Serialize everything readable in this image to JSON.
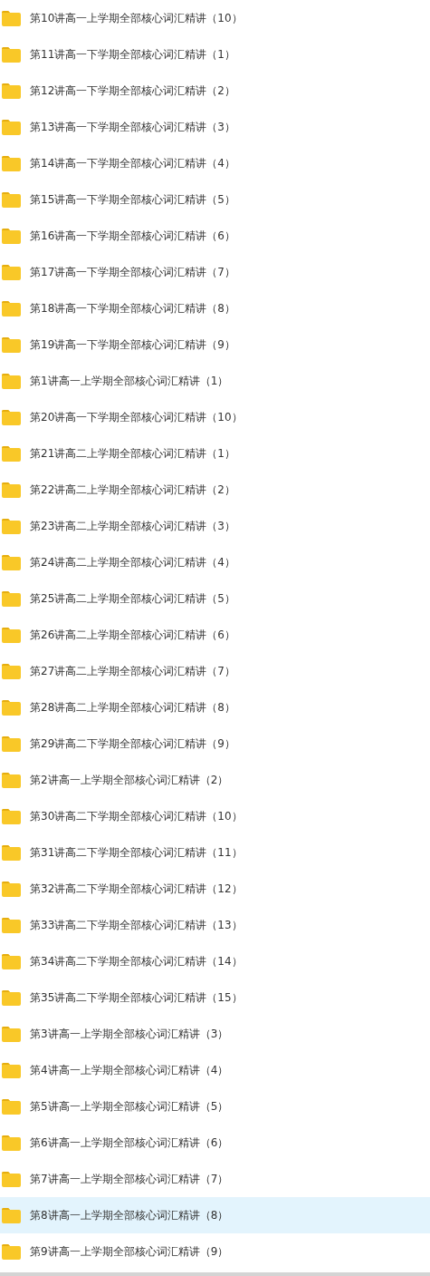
{
  "folders": [
    {
      "name": "第10讲高一上学期全部核心词汇精讲（10）",
      "selected": false
    },
    {
      "name": "第11讲高一下学期全部核心词汇精讲（1）",
      "selected": false
    },
    {
      "name": "第12讲高一下学期全部核心词汇精讲（2）",
      "selected": false
    },
    {
      "name": "第13讲高一下学期全部核心词汇精讲（3）",
      "selected": false
    },
    {
      "name": "第14讲高一下学期全部核心词汇精讲（4）",
      "selected": false
    },
    {
      "name": "第15讲高一下学期全部核心词汇精讲（5）",
      "selected": false
    },
    {
      "name": "第16讲高一下学期全部核心词汇精讲（6）",
      "selected": false
    },
    {
      "name": "第17讲高一下学期全部核心词汇精讲（7）",
      "selected": false
    },
    {
      "name": "第18讲高一下学期全部核心词汇精讲（8）",
      "selected": false
    },
    {
      "name": "第19讲高一下学期全部核心词汇精讲（9）",
      "selected": false
    },
    {
      "name": "第1讲高一上学期全部核心词汇精讲（1）",
      "selected": false
    },
    {
      "name": "第20讲高一下学期全部核心词汇精讲（10）",
      "selected": false
    },
    {
      "name": "第21讲高二上学期全部核心词汇精讲（1）",
      "selected": false
    },
    {
      "name": "第22讲高二上学期全部核心词汇精讲（2）",
      "selected": false
    },
    {
      "name": "第23讲高二上学期全部核心词汇精讲（3）",
      "selected": false
    },
    {
      "name": "第24讲高二上学期全部核心词汇精讲（4）",
      "selected": false
    },
    {
      "name": "第25讲高二上学期全部核心词汇精讲（5）",
      "selected": false
    },
    {
      "name": "第26讲高二上学期全部核心词汇精讲（6）",
      "selected": false
    },
    {
      "name": "第27讲高二上学期全部核心词汇精讲（7）",
      "selected": false
    },
    {
      "name": "第28讲高二上学期全部核心词汇精讲（8）",
      "selected": false
    },
    {
      "name": "第29讲高二下学期全部核心词汇精讲（9）",
      "selected": false
    },
    {
      "name": "第2讲高一上学期全部核心词汇精讲（2）",
      "selected": false
    },
    {
      "name": "第30讲高二下学期全部核心词汇精讲（10）",
      "selected": false
    },
    {
      "name": "第31讲高二下学期全部核心词汇精讲（11）",
      "selected": false
    },
    {
      "name": "第32讲高二下学期全部核心词汇精讲（12）",
      "selected": false
    },
    {
      "name": "第33讲高二下学期全部核心词汇精讲（13）",
      "selected": false
    },
    {
      "name": "第34讲高二下学期全部核心词汇精讲（14）",
      "selected": false
    },
    {
      "name": "第35讲高二下学期全部核心词汇精讲（15）",
      "selected": false
    },
    {
      "name": "第3讲高一上学期全部核心词汇精讲（3）",
      "selected": false
    },
    {
      "name": "第4讲高一上学期全部核心词汇精讲（4）",
      "selected": false
    },
    {
      "name": "第5讲高一上学期全部核心词汇精讲（5）",
      "selected": false
    },
    {
      "name": "第6讲高一上学期全部核心词汇精讲（6）",
      "selected": false
    },
    {
      "name": "第7讲高一上学期全部核心词汇精讲（7）",
      "selected": false
    },
    {
      "name": "第8讲高一上学期全部核心词汇精讲（8）",
      "selected": true
    },
    {
      "name": "第9讲高一上学期全部核心词汇精讲（9）",
      "selected": false
    }
  ]
}
